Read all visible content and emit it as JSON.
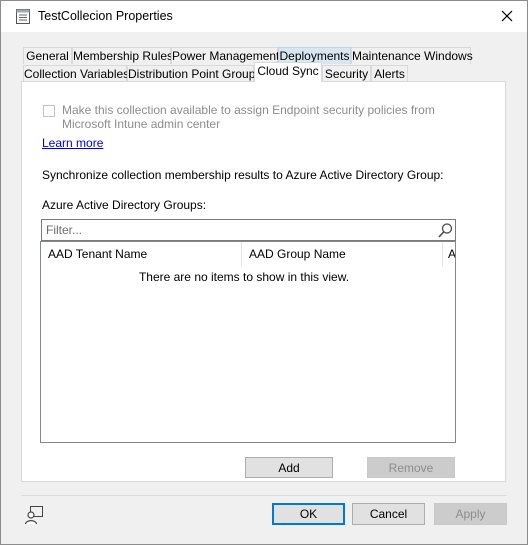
{
  "window": {
    "title": "TestCollecion Properties",
    "close_icon": "close-icon",
    "app_icon": "properties-icon"
  },
  "tabs": {
    "row1": [
      "General",
      "Membership Rules",
      "Power Management",
      "Deployments",
      "Maintenance Windows"
    ],
    "row2": [
      "Collection Variables",
      "Distribution Point Groups",
      "Cloud Sync",
      "Security",
      "Alerts"
    ],
    "active": "Cloud Sync"
  },
  "cloud_sync": {
    "checkbox_label": "Make this collection available to assign Endpoint security policies from Microsoft Intune admin center",
    "checkbox_checked": false,
    "learn_more": "Learn more",
    "sync_label": "Synchronize collection membership results to Azure Active Directory Group:",
    "groups_label": "Azure Active Directory Groups:",
    "filter_placeholder": "Filter...",
    "columns": [
      "AAD Tenant Name",
      "AAD Group Name",
      "A"
    ],
    "empty_message": "There are no items to show in this view.",
    "add_button": "Add",
    "remove_button": "Remove"
  },
  "footer": {
    "ok": "OK",
    "cancel": "Cancel",
    "apply": "Apply",
    "help_icon": "help-person-icon"
  },
  "colors": {
    "link": "#0000ee",
    "default_button_border": "#0078d7",
    "hover_tab": "#d8e6f2"
  }
}
